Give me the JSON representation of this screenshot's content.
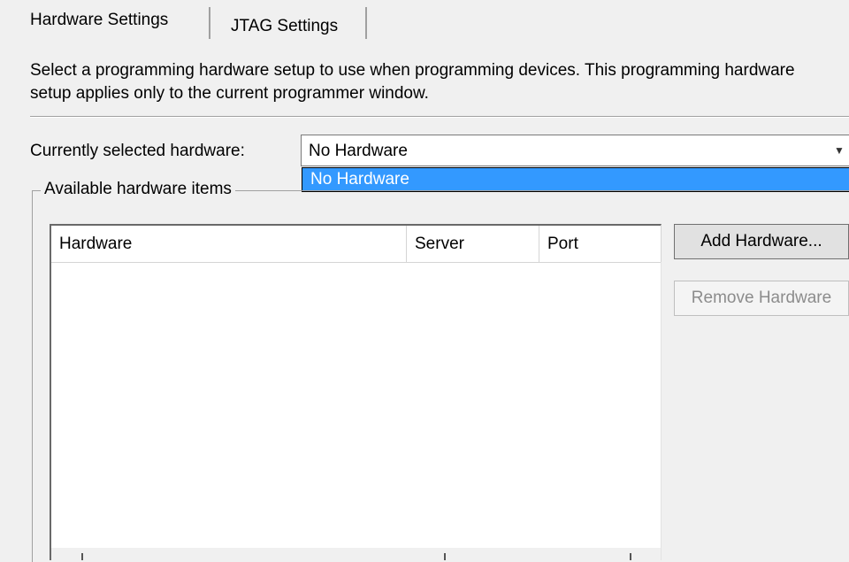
{
  "tabs": [
    {
      "label": "Hardware Settings",
      "active": true
    },
    {
      "label": "JTAG Settings",
      "active": false
    }
  ],
  "description": "Select a programming hardware setup to use when programming devices. This programming hardware setup applies only to the current programmer window.",
  "hardware_select": {
    "label": "Currently selected hardware:",
    "value": "No Hardware",
    "options": [
      "No Hardware"
    ],
    "highlighted_option": "No Hardware"
  },
  "available_group": {
    "legend": "Available hardware items",
    "columns": [
      "Hardware",
      "Server",
      "Port"
    ],
    "rows": []
  },
  "buttons": {
    "add": "Add Hardware...",
    "remove": "Remove Hardware"
  },
  "colors": {
    "window_bg": "#f0f0f0",
    "selection": "#3399ff",
    "disabled_text": "#8c8c8c"
  }
}
